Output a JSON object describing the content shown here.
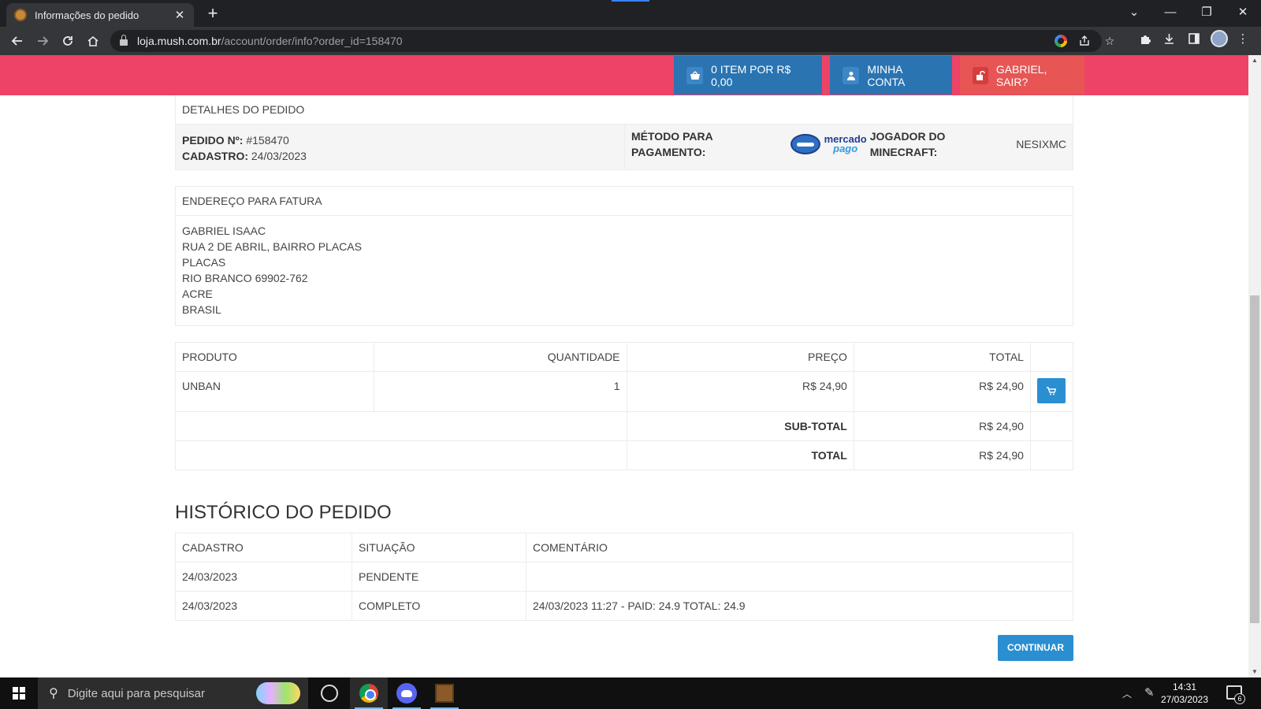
{
  "browser": {
    "tab_title": "Informações do pedido",
    "tab_close": "✕",
    "new_tab": "+",
    "url_host": "loja.mush.com.br",
    "url_path": "/account/order/info?order_id=158470",
    "window_controls": {
      "chevron": "⌄",
      "minimize": "—",
      "restore": "❐",
      "close": "✕"
    }
  },
  "header": {
    "cart_label": "0 ITEM POR R$ 0,00",
    "account_label": "MINHA CONTA",
    "logout_label": "GABRIEL, SAIR?"
  },
  "order_details": {
    "heading": "DETALHES DO PEDIDO",
    "order_number_label": "PEDIDO Nº:",
    "order_number": "#158470",
    "date_label": "CADASTRO:",
    "date": "24/03/2023",
    "payment_label": "MÉTODO PARA PAGAMENTO:",
    "payment_logo_top": "mercado",
    "payment_logo_bottom": "pago",
    "player_label": "JOGADOR DO MINECRAFT:",
    "player": "NESIXMC"
  },
  "billing": {
    "heading": "ENDEREÇO PARA FATURA",
    "lines": [
      "GABRIEL ISAAC",
      "RUA 2 DE ABRIL, BAIRRO PLACAS",
      "PLACAS",
      "RIO BRANCO 69902-762",
      "ACRE",
      "BRASIL"
    ]
  },
  "products": {
    "headers": {
      "product": "PRODUTO",
      "quantity": "QUANTIDADE",
      "price": "PREÇO",
      "total": "TOTAL"
    },
    "rows": [
      {
        "product": "UNBAN",
        "quantity": "1",
        "price": "R$ 24,90",
        "total": "R$ 24,90"
      }
    ],
    "subtotal_label": "SUB-TOTAL",
    "subtotal": "R$ 24,90",
    "total_label": "TOTAL",
    "total": "R$ 24,90"
  },
  "history": {
    "title": "HISTÓRICO DO PEDIDO",
    "headers": {
      "date": "CADASTRO",
      "status": "SITUAÇÃO",
      "comment": "COMENTÁRIO"
    },
    "rows": [
      {
        "date": "24/03/2023",
        "status": "PENDENTE",
        "comment": ""
      },
      {
        "date": "24/03/2023",
        "status": "COMPLETO",
        "comment": "24/03/2023 11:27 - PAID: 24.9 TOTAL: 24.9"
      }
    ]
  },
  "continue_label": "CONTINUAR",
  "taskbar": {
    "search_placeholder": "Digite aqui para pesquisar",
    "time": "14:31",
    "date": "27/03/2023",
    "notification_count": "6"
  },
  "colors": {
    "header_bg": "#ee4266",
    "header_button": "#2a74b2",
    "logout_button": "#e75555",
    "primary_button": "#2a8fd0"
  }
}
